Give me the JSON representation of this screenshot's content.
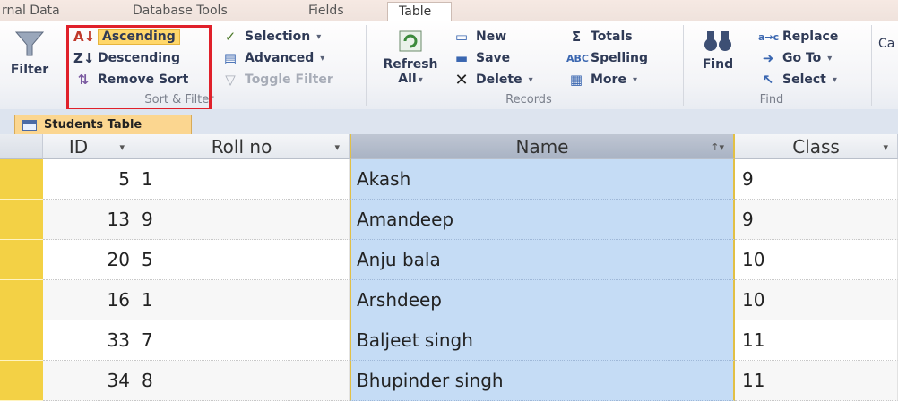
{
  "ribbon_tabs": [
    "rnal Data",
    "Database Tools",
    "Fields",
    "Table"
  ],
  "sort_filter": {
    "filter_label": "Filter",
    "ascending": "Ascending",
    "descending": "Descending",
    "remove_sort": "Remove Sort",
    "selection": "Selection",
    "advanced": "Advanced",
    "toggle_filter": "Toggle Filter",
    "group_label": "Sort & Filter"
  },
  "records": {
    "refresh": "Refresh",
    "refresh_all": "All",
    "new": "New",
    "save": "Save",
    "delete": "Delete",
    "totals": "Totals",
    "spelling": "Spelling",
    "more": "More",
    "group_label": "Records"
  },
  "find": {
    "find": "Find",
    "replace": "Replace",
    "goto": "Go To",
    "select": "Select",
    "group_label": "Find"
  },
  "cut_text": "Ca",
  "object_tab": "Students Table",
  "columns": {
    "id": "ID",
    "roll": "Roll no",
    "name": "Name",
    "class": "Class"
  },
  "rows": [
    {
      "id": "5",
      "roll": "1",
      "name": "Akash",
      "class": "9"
    },
    {
      "id": "13",
      "roll": "9",
      "name": "Amandeep",
      "class": "9"
    },
    {
      "id": "20",
      "roll": "5",
      "name": "Anju bala",
      "class": "10"
    },
    {
      "id": "16",
      "roll": "1",
      "name": "Arshdeep",
      "class": "10"
    },
    {
      "id": "33",
      "roll": "7",
      "name": "Baljeet singh",
      "class": "11"
    },
    {
      "id": "34",
      "roll": "8",
      "name": "Bhupinder singh",
      "class": "11"
    }
  ],
  "colors": {
    "highlight_box": "#e0202a",
    "selected_column": "#c5dcf5",
    "selector": "#f3d145"
  }
}
